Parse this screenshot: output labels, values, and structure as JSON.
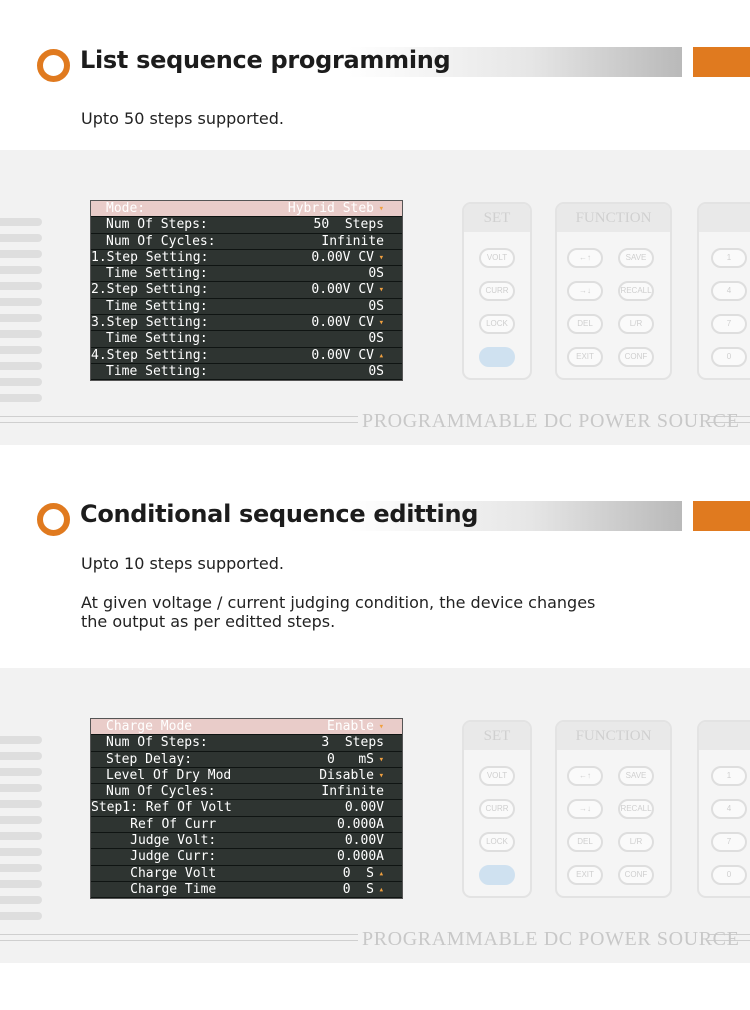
{
  "section1": {
    "title": "List sequence programming",
    "description": "Upto 50 steps supported.",
    "screen": [
      {
        "label": "Mode:",
        "value": "Hybrid Steb",
        "arrow": "▾",
        "highlight": true
      },
      {
        "label": "Num Of Steps:",
        "value": "50  Steps"
      },
      {
        "label": "Num Of Cycles:",
        "value": "Infinite"
      },
      {
        "label": "1.Step Setting:",
        "value": "0.00V CV",
        "arrow": "▾",
        "flush": true
      },
      {
        "label": "Time Setting:",
        "value": "0S"
      },
      {
        "label": "2.Step Setting:",
        "value": "0.00V CV",
        "arrow": "▾",
        "flush": true
      },
      {
        "label": "Time Setting:",
        "value": "0S"
      },
      {
        "label": "3.Step Setting:",
        "value": "0.00V CV",
        "arrow": "▾",
        "flush": true
      },
      {
        "label": "Time Setting:",
        "value": "0S"
      },
      {
        "label": "4.Step Setting:",
        "value": "0.00V CV",
        "arrow": "▴",
        "flush": true
      },
      {
        "label": "Time Setting:",
        "value": "0S"
      }
    ]
  },
  "section2": {
    "title": "Conditional sequence editting",
    "description_line1": "Upto 10 steps supported.",
    "description_line2": "At given voltage / current judging condition, the device changes",
    "description_line3": "the output as per editted steps.",
    "screen": [
      {
        "label": "Charge Mode",
        "value": "Enable",
        "arrow": "▾",
        "highlight": true
      },
      {
        "label": "Num Of Steps:",
        "value": "3  Steps"
      },
      {
        "label": "Step Delay:",
        "value": "0   mS",
        "arrow": "▾"
      },
      {
        "label": "Level Of Dry Mod",
        "value": "Disable",
        "arrow": "▾"
      },
      {
        "label": "Num Of Cycles:",
        "value": "Infinite"
      },
      {
        "label": "Step1: Ref Of Volt",
        "value": "0.00V",
        "flush": true
      },
      {
        "label": "     Ref Of Curr",
        "value": "0.000A",
        "flush": true
      },
      {
        "label": "     Judge Volt:",
        "value": "0.00V",
        "flush": true
      },
      {
        "label": "     Judge Curr:",
        "value": "0.000A",
        "flush": true
      },
      {
        "label": "     Charge Volt",
        "value": "0  S",
        "arrow": "▴",
        "flush": true
      },
      {
        "label": "     Charge Time",
        "value": "0  S",
        "arrow": "▴",
        "flush": true
      }
    ]
  },
  "device": {
    "brand_text": "PROGRAMMABLE DC POWER SOURCE",
    "group_set": "SET",
    "group_function": "FUNCTION",
    "set_buttons": [
      "VOLT",
      "CURR",
      "LOCK",
      ""
    ],
    "function_buttons_left": [
      "←↑",
      "→↓",
      "DEL",
      "EXIT"
    ],
    "function_buttons_right": [
      "SAVE",
      "RECALL",
      "L/R",
      "CONF"
    ],
    "num_buttons": [
      "1",
      "4",
      "7",
      "0"
    ]
  },
  "colors": {
    "accent": "#e07a1f",
    "lcd_background": "#2e3431",
    "lcd_highlight": "#e9ccc9",
    "panel": "#f2f2f2"
  }
}
